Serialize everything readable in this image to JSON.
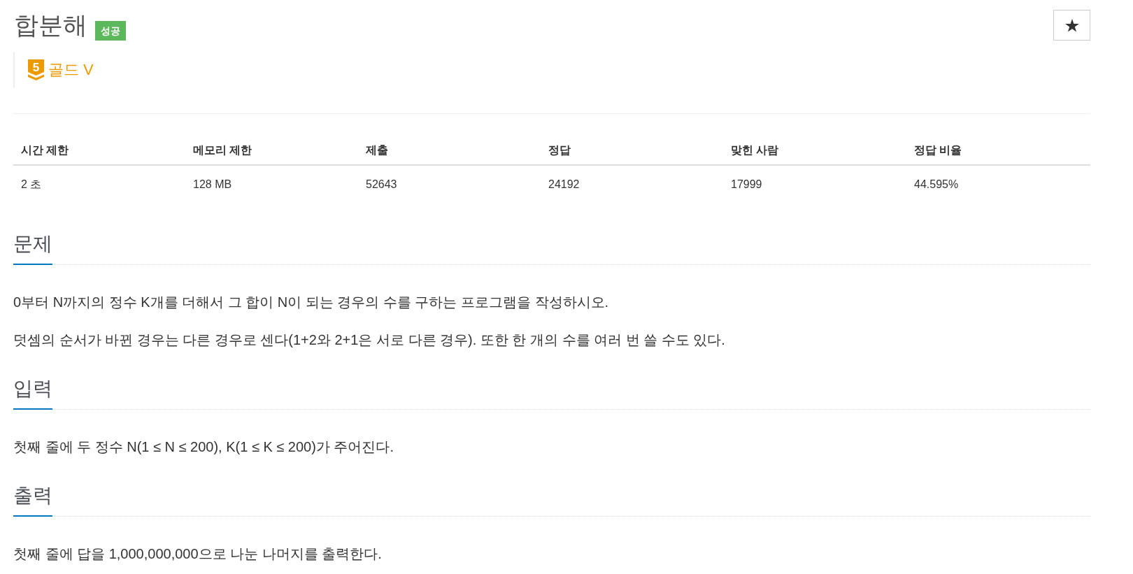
{
  "problem": {
    "title": "합분해",
    "badge": "성공",
    "tier": {
      "number": "5",
      "name": "골드 V"
    }
  },
  "info_table": {
    "columns": [
      "시간 제한",
      "메모리 제한",
      "제출",
      "정답",
      "맞힌 사람",
      "정답 비율"
    ],
    "rows": [
      [
        "2 초",
        "128 MB",
        "52643",
        "24192",
        "17999",
        "44.595%"
      ]
    ]
  },
  "sections": [
    {
      "heading": "문제",
      "paragraphs": [
        "0부터 N까지의 정수 K개를 더해서 그 합이 N이 되는 경우의 수를 구하는 프로그램을 작성하시오.",
        "덧셈의 순서가 바뀐 경우는 다른 경우로 센다(1+2와 2+1은 서로 다른 경우). 또한 한 개의 수를 여러 번 쓸 수도 있다."
      ]
    },
    {
      "heading": "입력",
      "paragraphs": [
        "첫째 줄에 두 정수 N(1 ≤ N ≤ 200), K(1 ≤ K ≤ 200)가 주어진다."
      ]
    },
    {
      "heading": "출력",
      "paragraphs": [
        "첫째 줄에 답을 1,000,000,000으로 나눈 나머지를 출력한다."
      ]
    }
  ]
}
